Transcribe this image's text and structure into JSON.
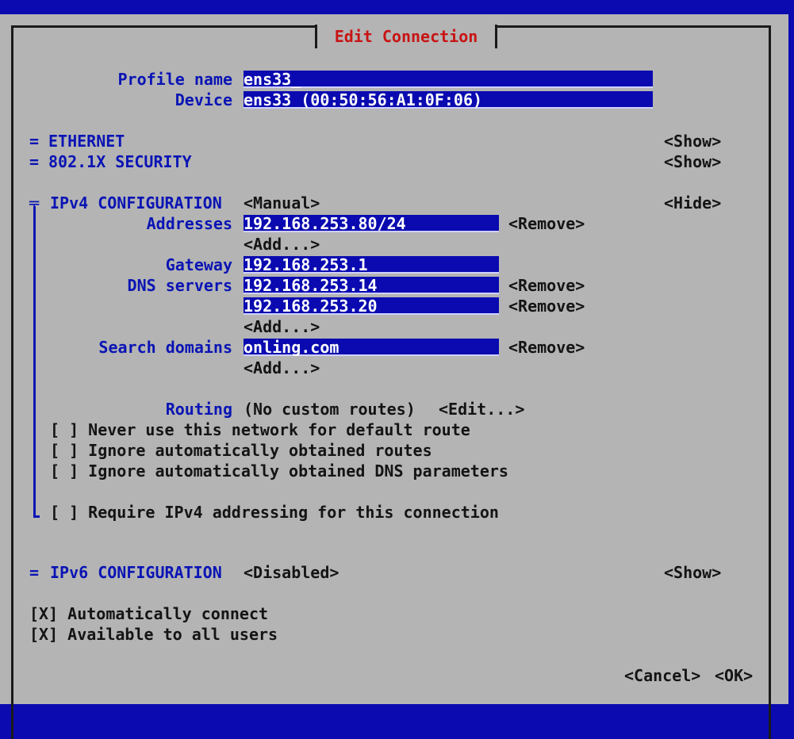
{
  "dialog": {
    "title": "Edit Connection"
  },
  "profile": {
    "name_label": "Profile name",
    "name_value": "ens33_",
    "device_label": "Device",
    "device_value": "ens33 (00:50:56:A1:0F:06)"
  },
  "ethernet": {
    "marker": "=",
    "label": "ETHERNET",
    "toggle": "<Show>"
  },
  "security": {
    "marker": "=",
    "label": "802.1X SECURITY",
    "toggle": "<Show>"
  },
  "ipv4": {
    "marker": "╤",
    "label": "IPv4 CONFIGURATION",
    "mode": "<Manual>",
    "toggle": "<Hide>",
    "addresses_label": "Addresses",
    "addresses": [
      "192.168.253.80/24"
    ],
    "gateway_label": "Gateway",
    "gateway": "192.168.253.1",
    "dns_label": "DNS servers",
    "dns_servers": [
      "192.168.253.14",
      "192.168.253.20"
    ],
    "search_label": "Search domains",
    "search_domains": [
      "onling.com"
    ],
    "remove_label": "<Remove>",
    "add_label": "<Add...>",
    "routing_label": "Routing",
    "routing_value": "(No custom routes)",
    "routing_edit": "<Edit...>",
    "checkbox_never_default": "[ ] Never use this network for default route",
    "checkbox_ignore_routes": "[ ] Ignore automatically obtained routes",
    "checkbox_ignore_dns": "[ ] Ignore automatically obtained DNS parameters",
    "checkbox_require": "[ ] Require IPv4 addressing for this connection"
  },
  "ipv6": {
    "marker": "=",
    "label": "IPv6 CONFIGURATION",
    "mode": "<Disabled>",
    "toggle": "<Show>"
  },
  "options": {
    "auto_connect": "[X] Automatically connect",
    "all_users": "[X] Available to all users"
  },
  "buttons": {
    "cancel": "<Cancel>",
    "ok": "<OK>"
  },
  "colors": {
    "background": "#0a0ab0",
    "panel": "#b4b4b4",
    "label": "#0a14b4",
    "field": "#0a0ab0",
    "title": "#c81414"
  }
}
